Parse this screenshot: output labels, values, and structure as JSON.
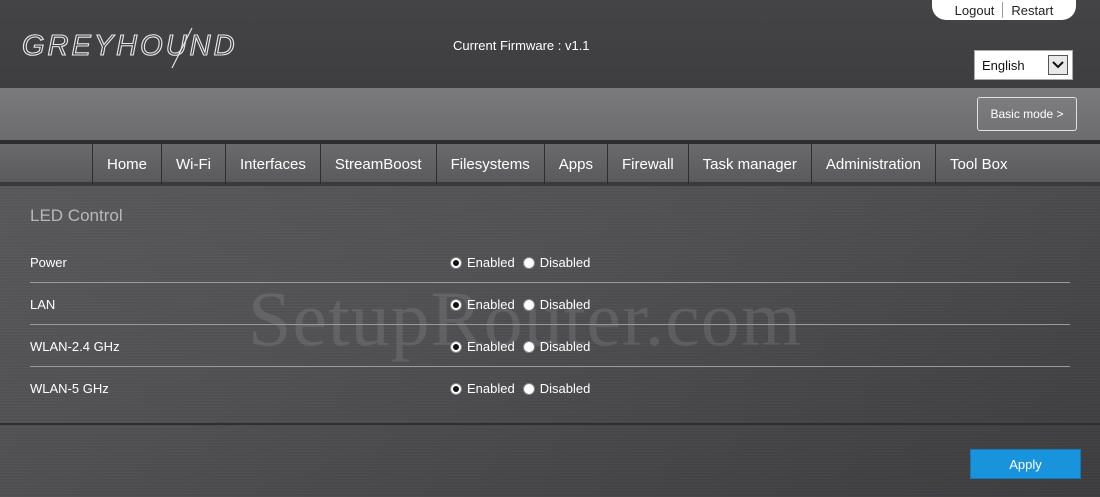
{
  "header": {
    "logo_text": "GREYHOUND",
    "firmware_text": "Current Firmware : v1.1",
    "logout_label": "Logout",
    "restart_label": "Restart",
    "language": {
      "selected": "English"
    }
  },
  "mode_button_label": "Basic mode >",
  "nav": {
    "items": [
      {
        "label": "Home"
      },
      {
        "label": "Wi-Fi"
      },
      {
        "label": "Interfaces"
      },
      {
        "label": "StreamBoost"
      },
      {
        "label": "Filesystems"
      },
      {
        "label": "Apps"
      },
      {
        "label": "Firewall"
      },
      {
        "label": "Task manager"
      },
      {
        "label": "Administration"
      },
      {
        "label": "Tool Box"
      }
    ]
  },
  "content": {
    "section_title": "LED Control",
    "watermark": "SetupRouter.com",
    "rows": [
      {
        "label": "Power",
        "enabled_label": "Enabled",
        "disabled_label": "Disabled",
        "selected": "Enabled"
      },
      {
        "label": "LAN",
        "enabled_label": "Enabled",
        "disabled_label": "Disabled",
        "selected": "Enabled"
      },
      {
        "label": "WLAN-2.4 GHz",
        "enabled_label": "Enabled",
        "disabled_label": "Disabled",
        "selected": "Enabled"
      },
      {
        "label": "WLAN-5 GHz",
        "enabled_label": "Enabled",
        "disabled_label": "Disabled",
        "selected": "Enabled"
      }
    ],
    "apply_label": "Apply"
  },
  "colors": {
    "accent": "#1993dc",
    "header_bg": "#444446",
    "nav_bg": "#616163"
  }
}
